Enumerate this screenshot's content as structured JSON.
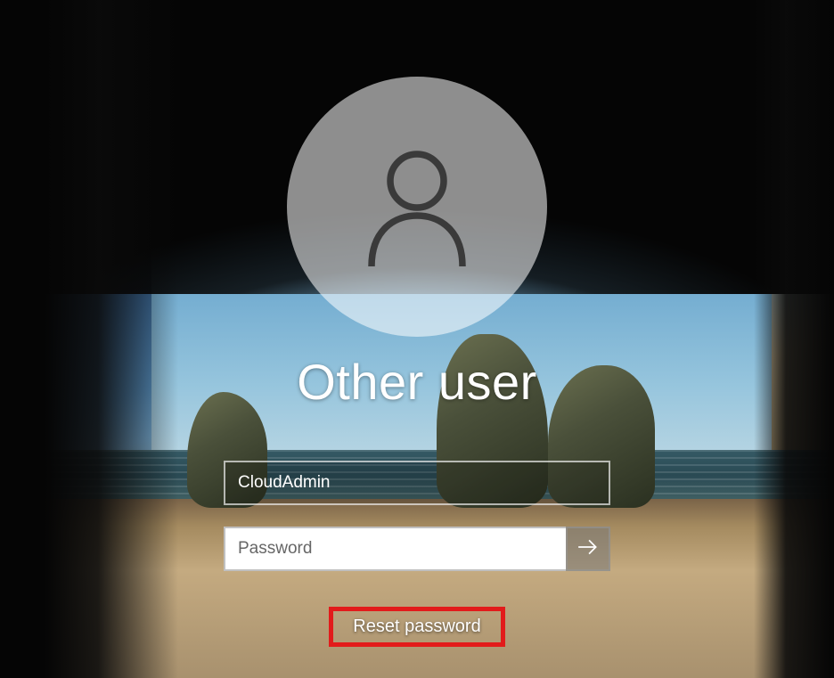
{
  "title": "Other user",
  "username": {
    "value": "CloudAdmin"
  },
  "password": {
    "value": "",
    "placeholder": "Password"
  },
  "reset_link": "Reset password",
  "icons": {
    "avatar": "person-icon",
    "submit": "arrow-right-icon"
  },
  "highlight": {
    "color": "#e21b1b"
  }
}
